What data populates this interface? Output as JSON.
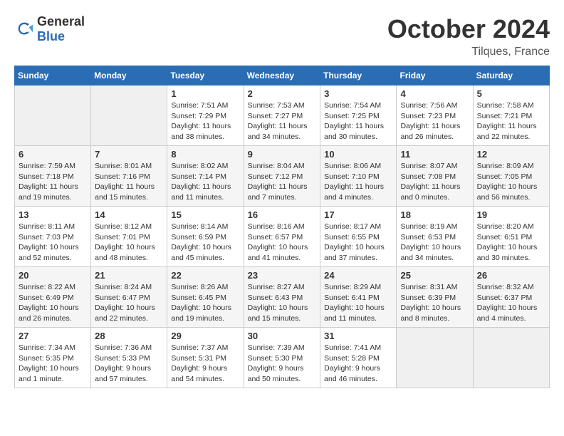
{
  "header": {
    "logo": {
      "general": "General",
      "blue": "Blue"
    },
    "month": "October 2024",
    "location": "Tilques, France"
  },
  "weekdays": [
    "Sunday",
    "Monday",
    "Tuesday",
    "Wednesday",
    "Thursday",
    "Friday",
    "Saturday"
  ],
  "weeks": [
    [
      {
        "day": "",
        "empty": true
      },
      {
        "day": "",
        "empty": true
      },
      {
        "day": "1",
        "sunrise": "Sunrise: 7:51 AM",
        "sunset": "Sunset: 7:29 PM",
        "daylight": "Daylight: 11 hours and 38 minutes."
      },
      {
        "day": "2",
        "sunrise": "Sunrise: 7:53 AM",
        "sunset": "Sunset: 7:27 PM",
        "daylight": "Daylight: 11 hours and 34 minutes."
      },
      {
        "day": "3",
        "sunrise": "Sunrise: 7:54 AM",
        "sunset": "Sunset: 7:25 PM",
        "daylight": "Daylight: 11 hours and 30 minutes."
      },
      {
        "day": "4",
        "sunrise": "Sunrise: 7:56 AM",
        "sunset": "Sunset: 7:23 PM",
        "daylight": "Daylight: 11 hours and 26 minutes."
      },
      {
        "day": "5",
        "sunrise": "Sunrise: 7:58 AM",
        "sunset": "Sunset: 7:21 PM",
        "daylight": "Daylight: 11 hours and 22 minutes."
      }
    ],
    [
      {
        "day": "6",
        "sunrise": "Sunrise: 7:59 AM",
        "sunset": "Sunset: 7:18 PM",
        "daylight": "Daylight: 11 hours and 19 minutes."
      },
      {
        "day": "7",
        "sunrise": "Sunrise: 8:01 AM",
        "sunset": "Sunset: 7:16 PM",
        "daylight": "Daylight: 11 hours and 15 minutes."
      },
      {
        "day": "8",
        "sunrise": "Sunrise: 8:02 AM",
        "sunset": "Sunset: 7:14 PM",
        "daylight": "Daylight: 11 hours and 11 minutes."
      },
      {
        "day": "9",
        "sunrise": "Sunrise: 8:04 AM",
        "sunset": "Sunset: 7:12 PM",
        "daylight": "Daylight: 11 hours and 7 minutes."
      },
      {
        "day": "10",
        "sunrise": "Sunrise: 8:06 AM",
        "sunset": "Sunset: 7:10 PM",
        "daylight": "Daylight: 11 hours and 4 minutes."
      },
      {
        "day": "11",
        "sunrise": "Sunrise: 8:07 AM",
        "sunset": "Sunset: 7:08 PM",
        "daylight": "Daylight: 11 hours and 0 minutes."
      },
      {
        "day": "12",
        "sunrise": "Sunrise: 8:09 AM",
        "sunset": "Sunset: 7:05 PM",
        "daylight": "Daylight: 10 hours and 56 minutes."
      }
    ],
    [
      {
        "day": "13",
        "sunrise": "Sunrise: 8:11 AM",
        "sunset": "Sunset: 7:03 PM",
        "daylight": "Daylight: 10 hours and 52 minutes."
      },
      {
        "day": "14",
        "sunrise": "Sunrise: 8:12 AM",
        "sunset": "Sunset: 7:01 PM",
        "daylight": "Daylight: 10 hours and 48 minutes."
      },
      {
        "day": "15",
        "sunrise": "Sunrise: 8:14 AM",
        "sunset": "Sunset: 6:59 PM",
        "daylight": "Daylight: 10 hours and 45 minutes."
      },
      {
        "day": "16",
        "sunrise": "Sunrise: 8:16 AM",
        "sunset": "Sunset: 6:57 PM",
        "daylight": "Daylight: 10 hours and 41 minutes."
      },
      {
        "day": "17",
        "sunrise": "Sunrise: 8:17 AM",
        "sunset": "Sunset: 6:55 PM",
        "daylight": "Daylight: 10 hours and 37 minutes."
      },
      {
        "day": "18",
        "sunrise": "Sunrise: 8:19 AM",
        "sunset": "Sunset: 6:53 PM",
        "daylight": "Daylight: 10 hours and 34 minutes."
      },
      {
        "day": "19",
        "sunrise": "Sunrise: 8:20 AM",
        "sunset": "Sunset: 6:51 PM",
        "daylight": "Daylight: 10 hours and 30 minutes."
      }
    ],
    [
      {
        "day": "20",
        "sunrise": "Sunrise: 8:22 AM",
        "sunset": "Sunset: 6:49 PM",
        "daylight": "Daylight: 10 hours and 26 minutes."
      },
      {
        "day": "21",
        "sunrise": "Sunrise: 8:24 AM",
        "sunset": "Sunset: 6:47 PM",
        "daylight": "Daylight: 10 hours and 22 minutes."
      },
      {
        "day": "22",
        "sunrise": "Sunrise: 8:26 AM",
        "sunset": "Sunset: 6:45 PM",
        "daylight": "Daylight: 10 hours and 19 minutes."
      },
      {
        "day": "23",
        "sunrise": "Sunrise: 8:27 AM",
        "sunset": "Sunset: 6:43 PM",
        "daylight": "Daylight: 10 hours and 15 minutes."
      },
      {
        "day": "24",
        "sunrise": "Sunrise: 8:29 AM",
        "sunset": "Sunset: 6:41 PM",
        "daylight": "Daylight: 10 hours and 11 minutes."
      },
      {
        "day": "25",
        "sunrise": "Sunrise: 8:31 AM",
        "sunset": "Sunset: 6:39 PM",
        "daylight": "Daylight: 10 hours and 8 minutes."
      },
      {
        "day": "26",
        "sunrise": "Sunrise: 8:32 AM",
        "sunset": "Sunset: 6:37 PM",
        "daylight": "Daylight: 10 hours and 4 minutes."
      }
    ],
    [
      {
        "day": "27",
        "sunrise": "Sunrise: 7:34 AM",
        "sunset": "Sunset: 5:35 PM",
        "daylight": "Daylight: 10 hours and 1 minute."
      },
      {
        "day": "28",
        "sunrise": "Sunrise: 7:36 AM",
        "sunset": "Sunset: 5:33 PM",
        "daylight": "Daylight: 9 hours and 57 minutes."
      },
      {
        "day": "29",
        "sunrise": "Sunrise: 7:37 AM",
        "sunset": "Sunset: 5:31 PM",
        "daylight": "Daylight: 9 hours and 54 minutes."
      },
      {
        "day": "30",
        "sunrise": "Sunrise: 7:39 AM",
        "sunset": "Sunset: 5:30 PM",
        "daylight": "Daylight: 9 hours and 50 minutes."
      },
      {
        "day": "31",
        "sunrise": "Sunrise: 7:41 AM",
        "sunset": "Sunset: 5:28 PM",
        "daylight": "Daylight: 9 hours and 46 minutes."
      },
      {
        "day": "",
        "empty": true
      },
      {
        "day": "",
        "empty": true
      }
    ]
  ]
}
